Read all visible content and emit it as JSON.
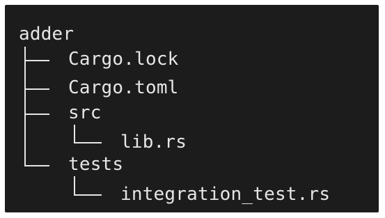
{
  "tree": {
    "root": "adder",
    "items": [
      {
        "name": "Cargo.lock"
      },
      {
        "name": "Cargo.toml"
      },
      {
        "name": "src",
        "children": [
          {
            "name": "lib.rs"
          }
        ]
      },
      {
        "name": "tests",
        "children": [
          {
            "name": "integration_test.rs"
          }
        ]
      }
    ]
  }
}
